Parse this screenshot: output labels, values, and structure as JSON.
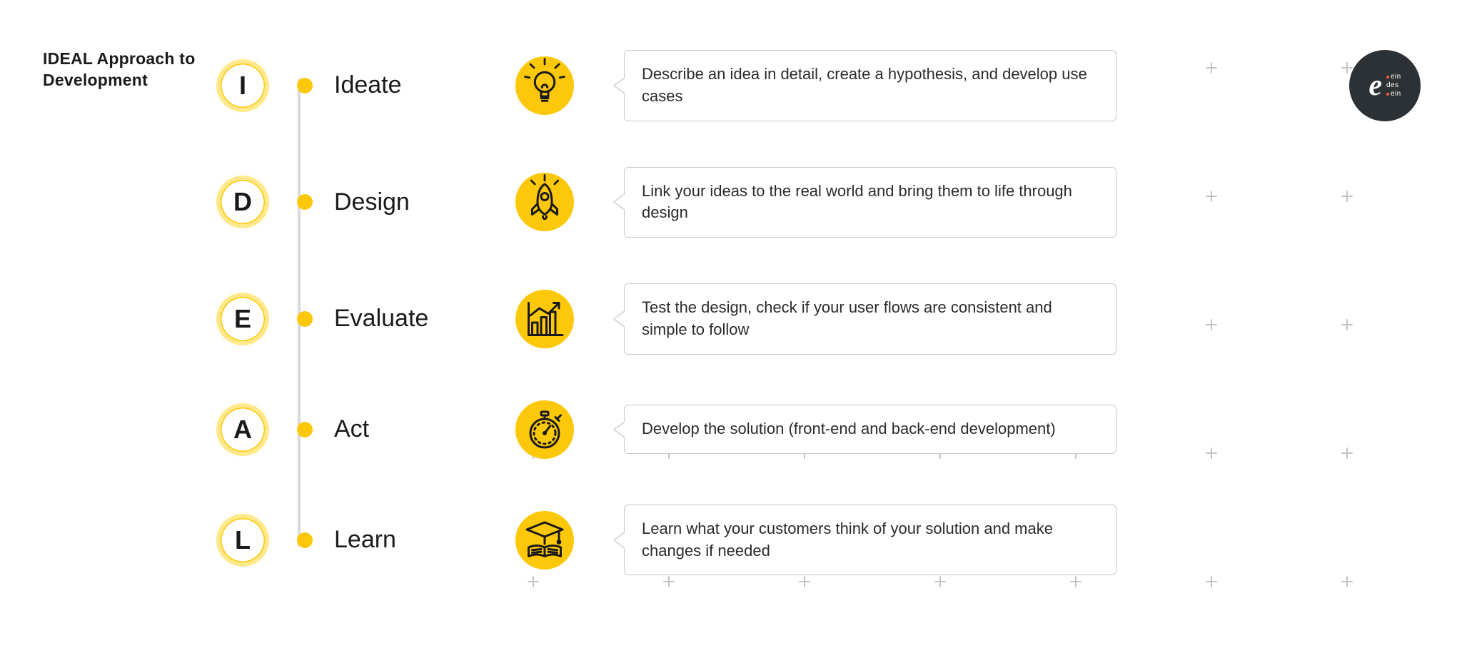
{
  "title": "IDEAL Approach to Development",
  "brand": {
    "mark_glyph": "e",
    "name_lines": [
      "ein",
      "des",
      "ein"
    ],
    "accent_color": "#ff5a3c",
    "bg_color": "#2c3136"
  },
  "colors": {
    "accent": "#fdc80a",
    "connector": "#d9d9d9",
    "border": "#c9c9c9",
    "text": "#1a1a1a"
  },
  "steps": [
    {
      "letter": "I",
      "name": "Ideate",
      "icon": "lightbulb-icon",
      "description": "Describe an idea in detail, create a hypothesis, and develop use cases"
    },
    {
      "letter": "D",
      "name": "Design",
      "icon": "rocket-icon",
      "description": "Link your ideas to the real world and bring them to life through design"
    },
    {
      "letter": "E",
      "name": "Evaluate",
      "icon": "analytics-chart-icon",
      "description": "Test the design, check if your user flows are consistent and simple to follow"
    },
    {
      "letter": "A",
      "name": "Act",
      "icon": "stopwatch-icon",
      "description": "Develop the solution (front-end and back-end development)"
    },
    {
      "letter": "L",
      "name": "Learn",
      "icon": "graduation-book-icon",
      "description": "Learn what your customers think of your solution and make changes if needed"
    }
  ]
}
